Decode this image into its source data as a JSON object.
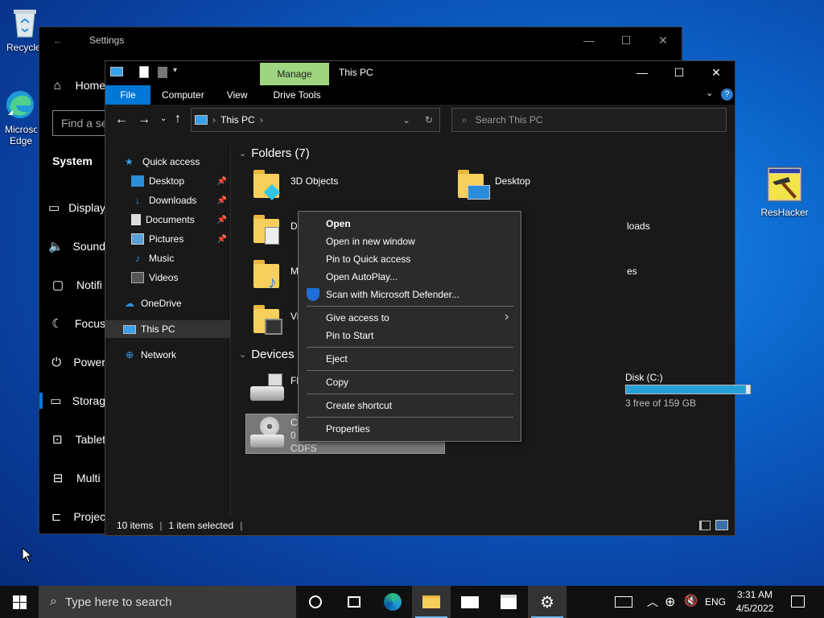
{
  "desktop": {
    "icons": [
      {
        "label": "Recycle Bin",
        "icon": "recycle-bin-icon"
      },
      {
        "label": "Microsoft Edge",
        "icon": "edge-icon"
      },
      {
        "label": "ResHacker",
        "icon": "reshacker-icon"
      }
    ]
  },
  "settings": {
    "title": "Settings",
    "home": "Home",
    "search_placeholder": "Find a se",
    "section": "System",
    "nav": [
      "Display",
      "Sound",
      "Notifi",
      "Focus",
      "Power",
      "Storag",
      "Tablet",
      "Multi",
      "Projec"
    ]
  },
  "explorer": {
    "title": "This PC",
    "manage_tab": "Manage",
    "tabs": [
      "File",
      "Computer",
      "View",
      "Drive Tools"
    ],
    "address": "This PC",
    "search_placeholder": "Search This PC",
    "nav": {
      "quick_access": "Quick access",
      "pinned": [
        "Desktop",
        "Downloads",
        "Documents",
        "Pictures"
      ],
      "other": [
        "Music",
        "Videos"
      ],
      "onedrive": "OneDrive",
      "this_pc": "This PC",
      "network": "Network"
    },
    "folders_header": "Folders (7)",
    "folders": [
      "3D Objects",
      "Desktop",
      "D",
      "loads",
      "M",
      "es",
      "Vi"
    ],
    "devices_header": "Devices a",
    "devices": {
      "floppy_label": "Fl",
      "disk_label": "Disk (C:)",
      "disk_free": "3 free of 159 GB",
      "cd_line1": "C",
      "cd_line2": "0",
      "cd_fs": "CDFS",
      "disk_used_fraction": 0.97
    },
    "status": {
      "items": "10 items",
      "selected": "1 item selected"
    }
  },
  "context_menu": {
    "items": [
      "Open",
      "Open in new window",
      "Pin to Quick access",
      "Open AutoPlay...",
      "Scan with Microsoft Defender...",
      "Give access to",
      "Pin to Start",
      "Eject",
      "Copy",
      "Create shortcut",
      "Properties"
    ]
  },
  "taskbar": {
    "search_placeholder": "Type here to search",
    "lang": "ENG",
    "time": "3:31 AM",
    "date": "4/5/2022"
  },
  "colors": {
    "accent": "#0078d7",
    "manage_tab": "#9ed47f",
    "folder": "#f6cf5c",
    "disk_bar": "#26a0da"
  }
}
